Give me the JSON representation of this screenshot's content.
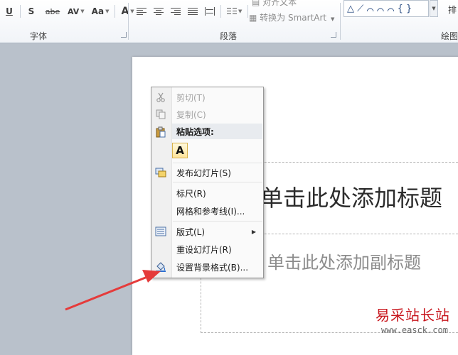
{
  "ribbon": {
    "font_group_label": "字体",
    "paragraph_group_label": "段落",
    "drawing_group_label": "绘图",
    "font_buttons": {
      "underline": "U",
      "shadow": "S",
      "strikethrough": "abe",
      "char_spacing": "AV",
      "change_case": "Aa",
      "font_color": "A"
    },
    "smartart_top_label": "对齐文本",
    "smartart_label": "转换为 SmartArt",
    "right_edge_label": "排",
    "shapes_preview": "△ ⟋ ⌒ ⌒ ⌒ { }"
  },
  "slide": {
    "title_placeholder": "单击此处添加标题",
    "subtitle_placeholder": "单击此处添加副标题"
  },
  "context_menu": {
    "cut": "剪切(T)",
    "copy": "复制(C)",
    "paste_options_header": "粘贴选项:",
    "paste_keep_text": "A",
    "publish_slides": "发布幻灯片(S)",
    "ruler": "标尺(R)",
    "grid_guides": "网格和参考线(I)...",
    "layout": "版式(L)",
    "reset_slide": "重设幻灯片(R)",
    "format_background": "设置背景格式(B)..."
  },
  "watermark": {
    "site_name": "易采站长站",
    "url": "www.easck.com"
  },
  "colors": {
    "accent_arrow": "#e53b3b",
    "menu_highlight": "#e8ebef"
  }
}
